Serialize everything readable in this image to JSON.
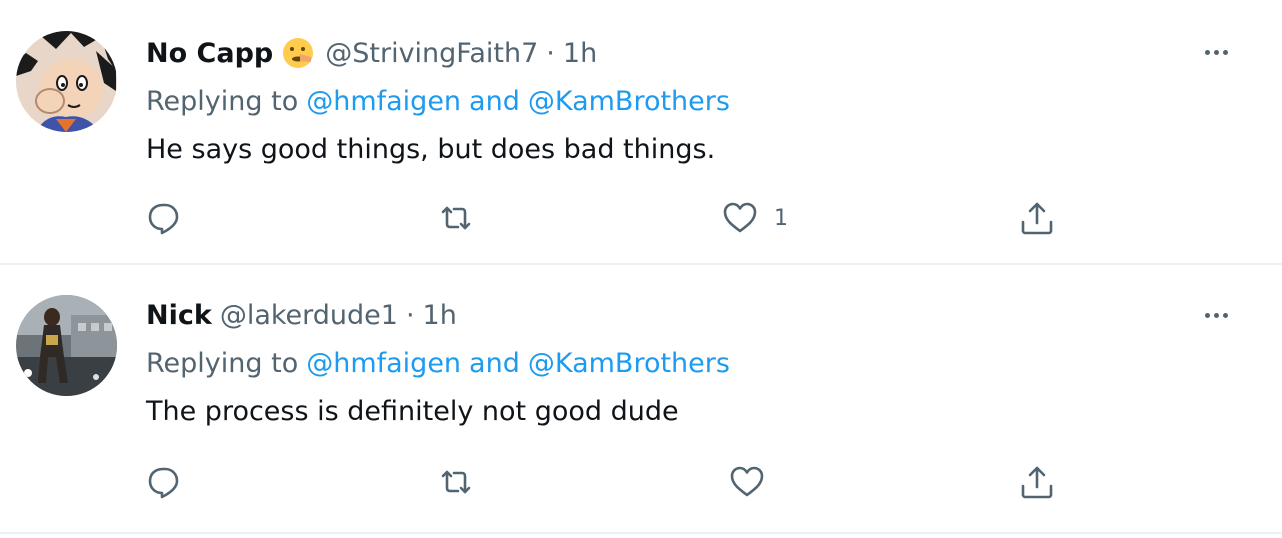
{
  "tweets": [
    {
      "display_name": "No Capp",
      "emoji": "shushing-face-emoji",
      "handle": "@StrivingFaith7",
      "separator": "·",
      "time": "1h",
      "replying_prefix": "Replying to",
      "mention_1": "@hmfaigen",
      "mention_and": "and",
      "mention_2": "@KamBrothers",
      "text": "He says good things, but does bad things.",
      "like_count": "1",
      "avatar": "cartoon-character-avatar"
    },
    {
      "display_name": "Nick",
      "handle": "@lakerdude1",
      "separator": "·",
      "time": "1h",
      "replying_prefix": "Replying to",
      "mention_1": "@hmfaigen",
      "mention_and": "and",
      "mention_2": "@KamBrothers",
      "text": "The process is definitely not good dude",
      "like_count": "",
      "avatar": "basketball-player-photo-avatar"
    }
  ],
  "icons": {
    "reply": "reply-icon",
    "retweet": "retweet-icon",
    "like": "heart-icon",
    "share": "share-icon",
    "more": "more-options-icon"
  },
  "colors": {
    "link": "#1d9bf0",
    "secondary_text": "#536471",
    "primary_text": "#0f1419",
    "divider": "#eef1f3"
  }
}
